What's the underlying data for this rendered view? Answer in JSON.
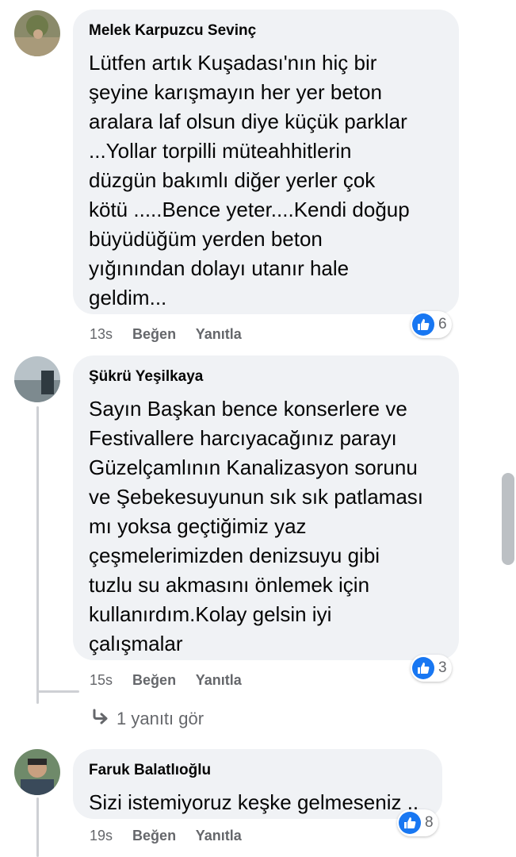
{
  "comments": [
    {
      "author": "Melek Karpuzcu Sevinç",
      "text": "Lütfen artık Kuşadası'nın hiç bir\nşeyine karışmayın her yer beton\naralara laf olsun diye küçük parklar\n...Yollar torpilli müteahhitlerin\ndüzgün bakımlı diğer yerler çok\nkötü .....Bence yeter....Kendi doğup\nbüyüdüğüm yerden beton\nyığınından dolayı utanır hale\ngeldim...",
      "time": "13s",
      "like": "Beğen",
      "reply": "Yanıtla",
      "reaction_count": "6"
    },
    {
      "author": "Şükrü Yeşilkaya",
      "text": "Sayın Başkan bence konserlere ve\nFestivallere harcıyacağınız parayı\nGüzelçamlının Kanalizasyon sorunu\nve Şebekesuyunun sık sık patlaması\nmı yoksa geçtiğimiz yaz\nçeşmelerimizden denizsuyu gibi\ntuzlu su akmasını önlemek için\nkullanırdım.Kolay gelsin iyi\nçalışmalar",
      "time": "15s",
      "like": "Beğen",
      "reply": "Yanıtla",
      "reaction_count": "3",
      "view_replies": "1 yanıtı gör"
    },
    {
      "author": "Faruk Balatlıoğlu",
      "text": "Sizi istemiyoruz keşke gelmeseniz ..",
      "time": "19s",
      "like": "Beğen",
      "reply": "Yanıtla",
      "reaction_count": "8"
    }
  ],
  "colors": {
    "bubble": "#f0f2f5",
    "like_blue": "#1877f2",
    "meta_gray": "#65676b"
  },
  "icons": {
    "reaction": "thumbs-up-icon",
    "reply_arrow": "reply-arrow-icon"
  }
}
